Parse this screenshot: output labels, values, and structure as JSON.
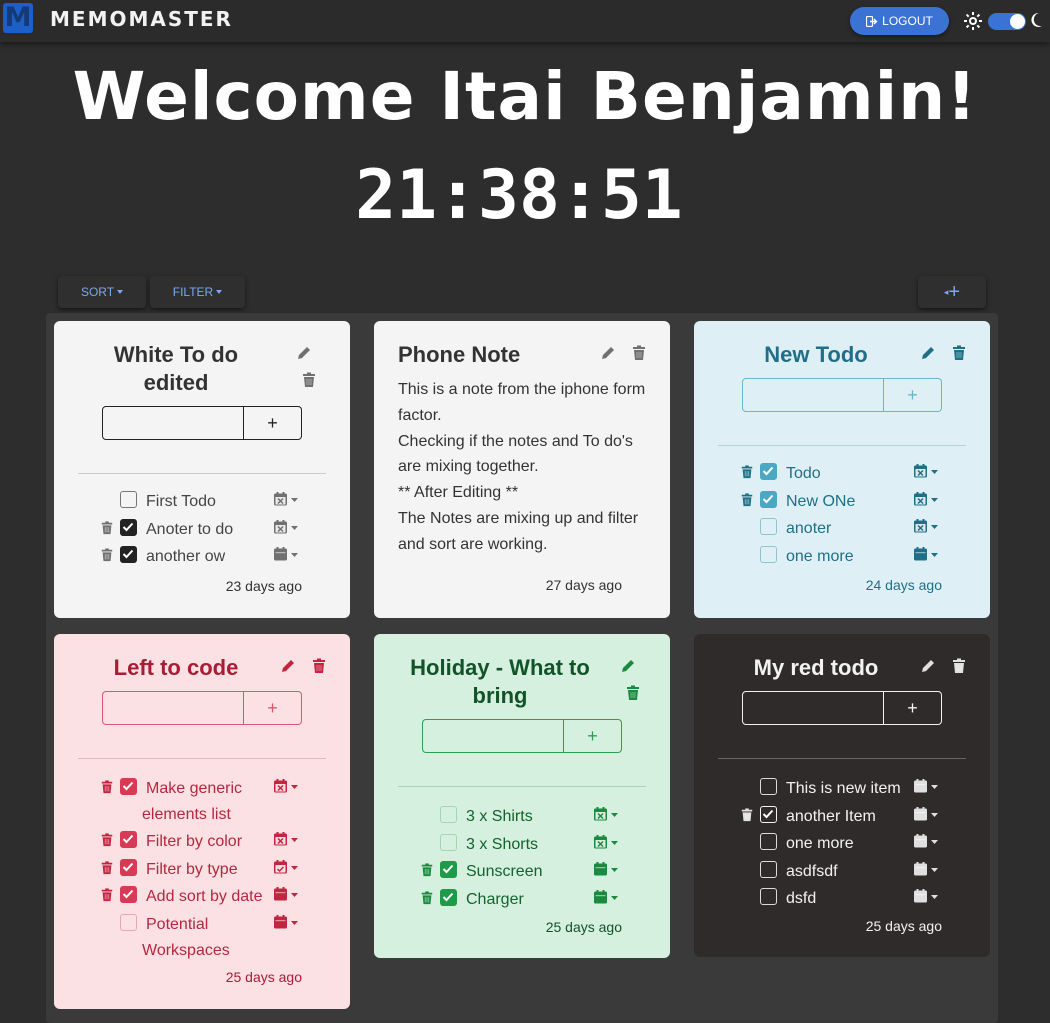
{
  "brand": {
    "logo_letter": "M",
    "name": "MEMOMASTER"
  },
  "header": {
    "logout_label": "LOGOUT",
    "welcome": "Welcome Itai Benjamin!",
    "clock": "21:38:51"
  },
  "theme_toggle": {
    "mode": "dark"
  },
  "toolbar": {
    "sort_label": "SORT",
    "filter_label": "FILTER",
    "add_label": "+"
  },
  "cards": [
    {
      "title_line1": "White To do",
      "title_line2": "edited",
      "color": "#f4f4f4",
      "accent": "#3a3a3a",
      "items": [
        {
          "text": "First Todo",
          "checked": false
        },
        {
          "text": "Anoter to do",
          "checked": true
        },
        {
          "text": "another ow",
          "checked": true
        }
      ],
      "time": "23 days ago",
      "add_button": "+"
    },
    {
      "title": "Phone Note",
      "color": "#f4f4f4",
      "accent": "#3a3a3a",
      "body": [
        "This is a note from the iphone form",
        "factor.",
        "Checking if the notes and To do's",
        "are mixing together.",
        "** After Editing **",
        "The Notes are mixing up and filter",
        "and sort are working."
      ],
      "time": "27 days ago"
    },
    {
      "title": "New Todo",
      "color": "#def0f5",
      "accent": "#1f6f87",
      "items": [
        {
          "text": "Todo",
          "checked": true
        },
        {
          "text": "New ONe",
          "checked": true
        },
        {
          "text": "anoter",
          "checked": false
        },
        {
          "text": "one more",
          "checked": false
        }
      ],
      "time": "24 days ago",
      "add_button": "+"
    },
    {
      "title": "Left to code",
      "color": "#fbe0e4",
      "accent": "#c3243f",
      "items": [
        {
          "text": "Make generic",
          "text2": "elements list",
          "checked": true
        },
        {
          "text": "Filter by color",
          "checked": true
        },
        {
          "text": "Filter by type",
          "checked": true
        },
        {
          "text": "Add sort by date",
          "checked": true
        },
        {
          "text": "Potential",
          "text2": "Workspaces",
          "checked": false
        }
      ],
      "time": "25 days ago",
      "add_button": "+"
    },
    {
      "title_line1": "Holiday - What to",
      "title_line2": "bring",
      "color": "#d5f0de",
      "accent": "#198a3e",
      "items": [
        {
          "text": "3 x Shirts",
          "checked": false
        },
        {
          "text": "3 x Shorts",
          "checked": false
        },
        {
          "text": "Sunscreen",
          "checked": true
        },
        {
          "text": "Charger",
          "checked": true
        }
      ],
      "time": "25 days ago",
      "add_button": "+"
    },
    {
      "title": "My red todo",
      "color": "#302b2b",
      "accent": "#f2f2f2",
      "items": [
        {
          "text": "This is new item",
          "checked": false
        },
        {
          "text": "another Item",
          "checked": true
        },
        {
          "text": "one more",
          "checked": false
        },
        {
          "text": "asdfsdf",
          "checked": false
        },
        {
          "text": "dsfd",
          "checked": false
        }
      ],
      "time": "25 days ago",
      "add_button": "+"
    }
  ]
}
